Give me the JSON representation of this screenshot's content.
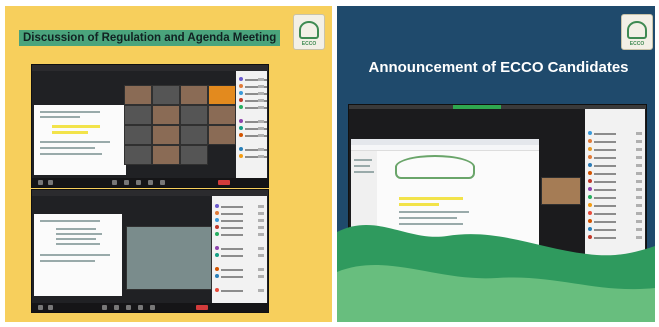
{
  "left_panel": {
    "title": "Discussion of Regulation and Agenda Meeting",
    "background_color": "#f7cf5c",
    "title_highlight_color": "#4aa47c",
    "logo_icon": "ecco-emblem-icon"
  },
  "right_panel": {
    "title": "Announcement of ECCO Candidates",
    "background_color": "#1f4a6c",
    "accent_green": "#2f9a5e",
    "logo_icon": "ecco-emblem-icon"
  },
  "logo": {
    "text": "ECCO"
  }
}
